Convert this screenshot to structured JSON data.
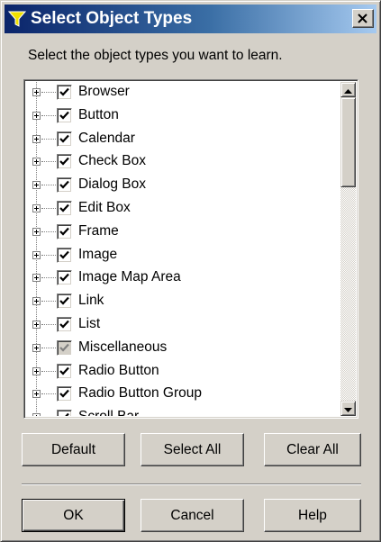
{
  "dialog": {
    "title": "Select Object Types",
    "title_icon": "funnel-icon",
    "close_icon": "close-icon"
  },
  "instruction": "Select the object types you want to learn.",
  "object_types": [
    {
      "label": "Browser",
      "checked": true,
      "state": "checked"
    },
    {
      "label": "Button",
      "checked": true,
      "state": "checked"
    },
    {
      "label": "Calendar",
      "checked": true,
      "state": "checked"
    },
    {
      "label": "Check Box",
      "checked": true,
      "state": "checked"
    },
    {
      "label": "Dialog Box",
      "checked": true,
      "state": "checked"
    },
    {
      "label": "Edit Box",
      "checked": true,
      "state": "checked"
    },
    {
      "label": "Frame",
      "checked": true,
      "state": "checked"
    },
    {
      "label": "Image",
      "checked": true,
      "state": "checked"
    },
    {
      "label": "Image Map Area",
      "checked": true,
      "state": "checked"
    },
    {
      "label": "Link",
      "checked": true,
      "state": "checked"
    },
    {
      "label": "List",
      "checked": true,
      "state": "checked"
    },
    {
      "label": "Miscellaneous",
      "checked": true,
      "state": "indeterminate"
    },
    {
      "label": "Radio Button",
      "checked": true,
      "state": "checked"
    },
    {
      "label": "Radio Button Group",
      "checked": true,
      "state": "checked"
    },
    {
      "label": "Scroll Bar",
      "checked": true,
      "state": "checked"
    }
  ],
  "buttons": {
    "default": "Default",
    "select_all": "Select All",
    "clear_all": "Clear All",
    "ok": "OK",
    "cancel": "Cancel",
    "help": "Help"
  },
  "colors": {
    "title_bar_start": "#0a246a",
    "title_bar_end": "#a6caf0",
    "face": "#d4d0c8"
  }
}
